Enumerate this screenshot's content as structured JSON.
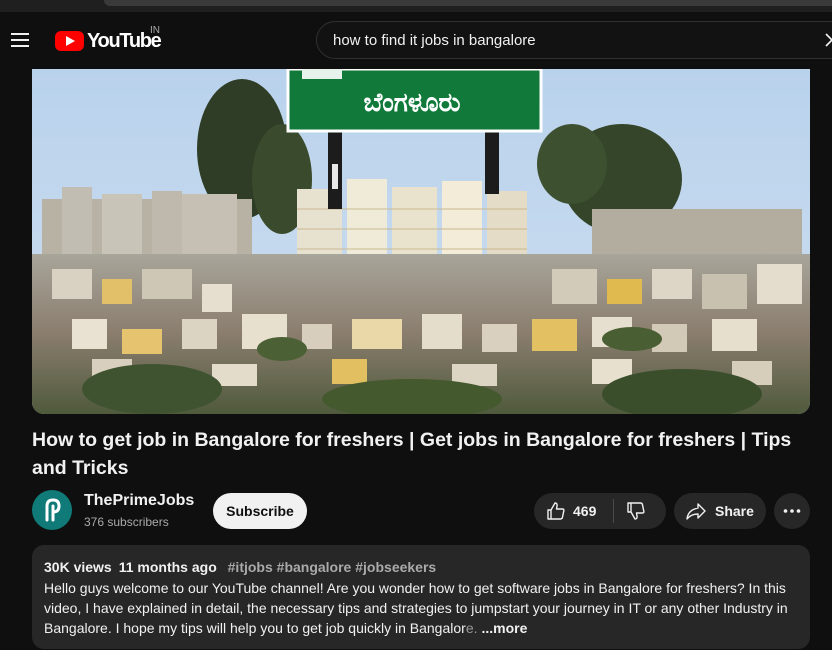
{
  "masthead": {
    "logo_text": "YouTube",
    "country_code": "IN",
    "search_query": "how to find it jobs in bangalore"
  },
  "video": {
    "thumbnail_sign_text": "ಬೆಂಗಳೂರು",
    "title": "How to get job in Bangalore for freshers | Get jobs in Bangalore for freshers | Tips and Tricks"
  },
  "channel": {
    "name": "ThePrimeJobs",
    "subscribers": "376 subscribers",
    "subscribe_label": "Subscribe"
  },
  "actions": {
    "like_count": "469",
    "share_label": "Share"
  },
  "description": {
    "views": "30K views",
    "age": "11 months ago",
    "hashtags": [
      "#itjobs",
      "#bangalore",
      "#jobseekers"
    ],
    "text": "Hello guys welcome to our YouTube channel! Are you wonder how to get software jobs in Bangalore for freshers? In this video, I have explained in detail, the necessary tips and strategies to jumpstart your journey in IT or any other Industry in Bangalore. I hope my tips will help you to  get job quickly in Bangalor",
    "fade_text": "e.",
    "more_label": "...more"
  },
  "colors": {
    "background": "#0f0f0f",
    "chip": "#272727",
    "brand_red": "#ff0000",
    "avatar_teal": "#0f7a77"
  }
}
